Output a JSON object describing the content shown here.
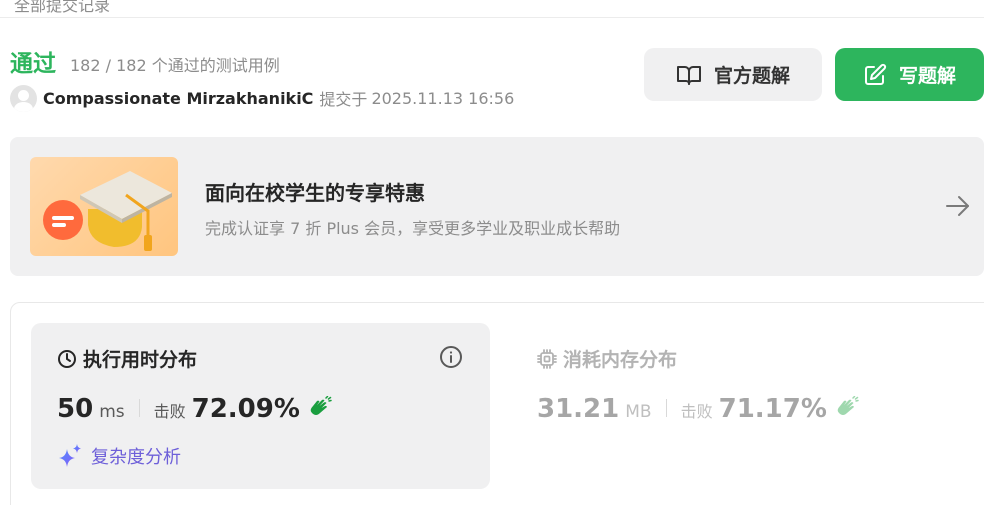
{
  "top_cut": {
    "text": "全部提交记录"
  },
  "result": {
    "status": "通过",
    "cases_text": "182 / 182 个通过的测试用例",
    "username": "Compassionate MirzakhanikiC",
    "submitted_label": "提交于",
    "submitted_time": "2025.11.13 16:56"
  },
  "buttons": {
    "official_solution": "官方题解",
    "write_solution": "写题解"
  },
  "promo": {
    "title": "面向在校学生的专享特惠",
    "subtitle": "完成认证享 7 折 Plus 会员，享受更多学业及职业成长帮助"
  },
  "runtime": {
    "title": "执行用时分布",
    "value": "50",
    "unit": "ms",
    "beats_label": "击败",
    "beats_pct": "72.09%",
    "complexity_label": "复杂度分析"
  },
  "memory": {
    "title": "消耗内存分布",
    "value": "31.21",
    "unit": "MB",
    "beats_label": "击败",
    "beats_pct": "71.17%"
  },
  "colors": {
    "accent_green": "#2db55d",
    "complexity_purple": "#6d5fd9",
    "panel_bg": "#f0f0f1"
  },
  "icons": {
    "official": "book-open-icon",
    "write": "edit-icon",
    "runtime": "clock-icon",
    "memory": "chip-icon",
    "info": "info-icon",
    "clap": "clap-icon",
    "sparkle": "sparkle-icon",
    "arrow": "arrow-right-icon"
  }
}
